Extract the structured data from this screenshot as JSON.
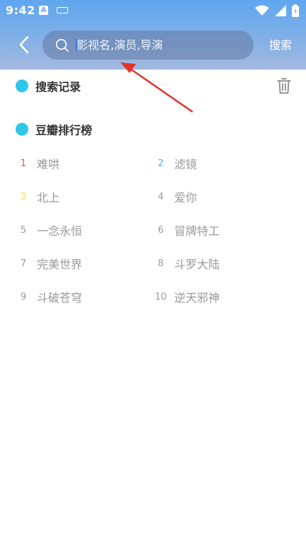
{
  "status_bar": {
    "time": "9:42",
    "a_badge": "A"
  },
  "header": {
    "back_icon": "chevron-left-icon",
    "search": {
      "placeholder": "影视名,演员,导演",
      "value": ""
    },
    "search_button_label": "搜索"
  },
  "sections": {
    "history": {
      "title": "搜索记录",
      "clear_icon": "trash-icon"
    },
    "ranking": {
      "title": "豆瓣排行榜"
    }
  },
  "ranking": [
    {
      "rank": "1",
      "title": "难哄",
      "color": "#f04f4f"
    },
    {
      "rank": "2",
      "title": "滤镜",
      "color": "#2ec7ea"
    },
    {
      "rank": "3",
      "title": "北上",
      "color": "#f2e64a"
    },
    {
      "rank": "4",
      "title": "爱你",
      "color": "#999999"
    },
    {
      "rank": "5",
      "title": "一念永恒",
      "color": "#999999"
    },
    {
      "rank": "6",
      "title": "冒牌特工",
      "color": "#999999"
    },
    {
      "rank": "7",
      "title": "完美世界",
      "color": "#999999"
    },
    {
      "rank": "8",
      "title": "斗罗大陆",
      "color": "#999999"
    },
    {
      "rank": "9",
      "title": "斗破苍穹",
      "color": "#999999"
    },
    {
      "rank": "10",
      "title": "逆天邪神",
      "color": "#999999"
    }
  ],
  "colors": {
    "accent_dot": "#2ec7ea",
    "annotation_arrow": "#e5332a"
  }
}
